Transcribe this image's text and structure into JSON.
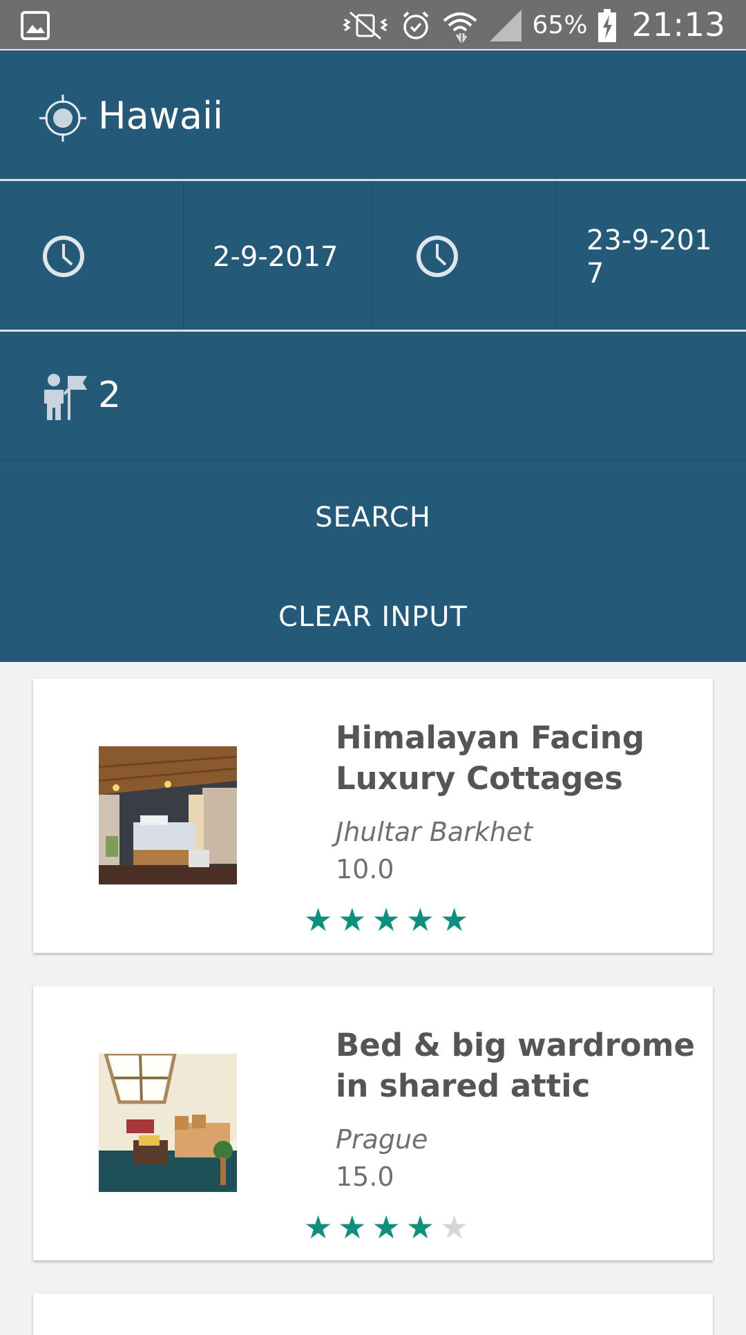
{
  "status_bar": {
    "icons": [
      "gallery-icon",
      "mute-vibrate-icon",
      "alarm-icon",
      "wifi-icon",
      "signal-icon",
      "battery-charging-icon"
    ],
    "battery": "65%",
    "time": "21:13"
  },
  "search_form": {
    "location": "Hawaii",
    "checkin_date": "2-9-2017",
    "checkout_date": "23-9-2017",
    "guests": "2",
    "search_label": "SEARCH",
    "clear_label": "CLEAR INPUT",
    "colors": {
      "panel": "#255978",
      "text": "#ffffff"
    }
  },
  "results": [
    {
      "title": "Himalayan Facing Luxury Cottages",
      "city": "Jhultar Barkhet",
      "price": "10.0",
      "rating": 5,
      "max_rating": 5
    },
    {
      "title": "Bed & big wardrome in shared attic",
      "city": "Prague",
      "price": "15.0",
      "rating": 4,
      "max_rating": 5
    }
  ],
  "star_color": "#0f8f7e"
}
